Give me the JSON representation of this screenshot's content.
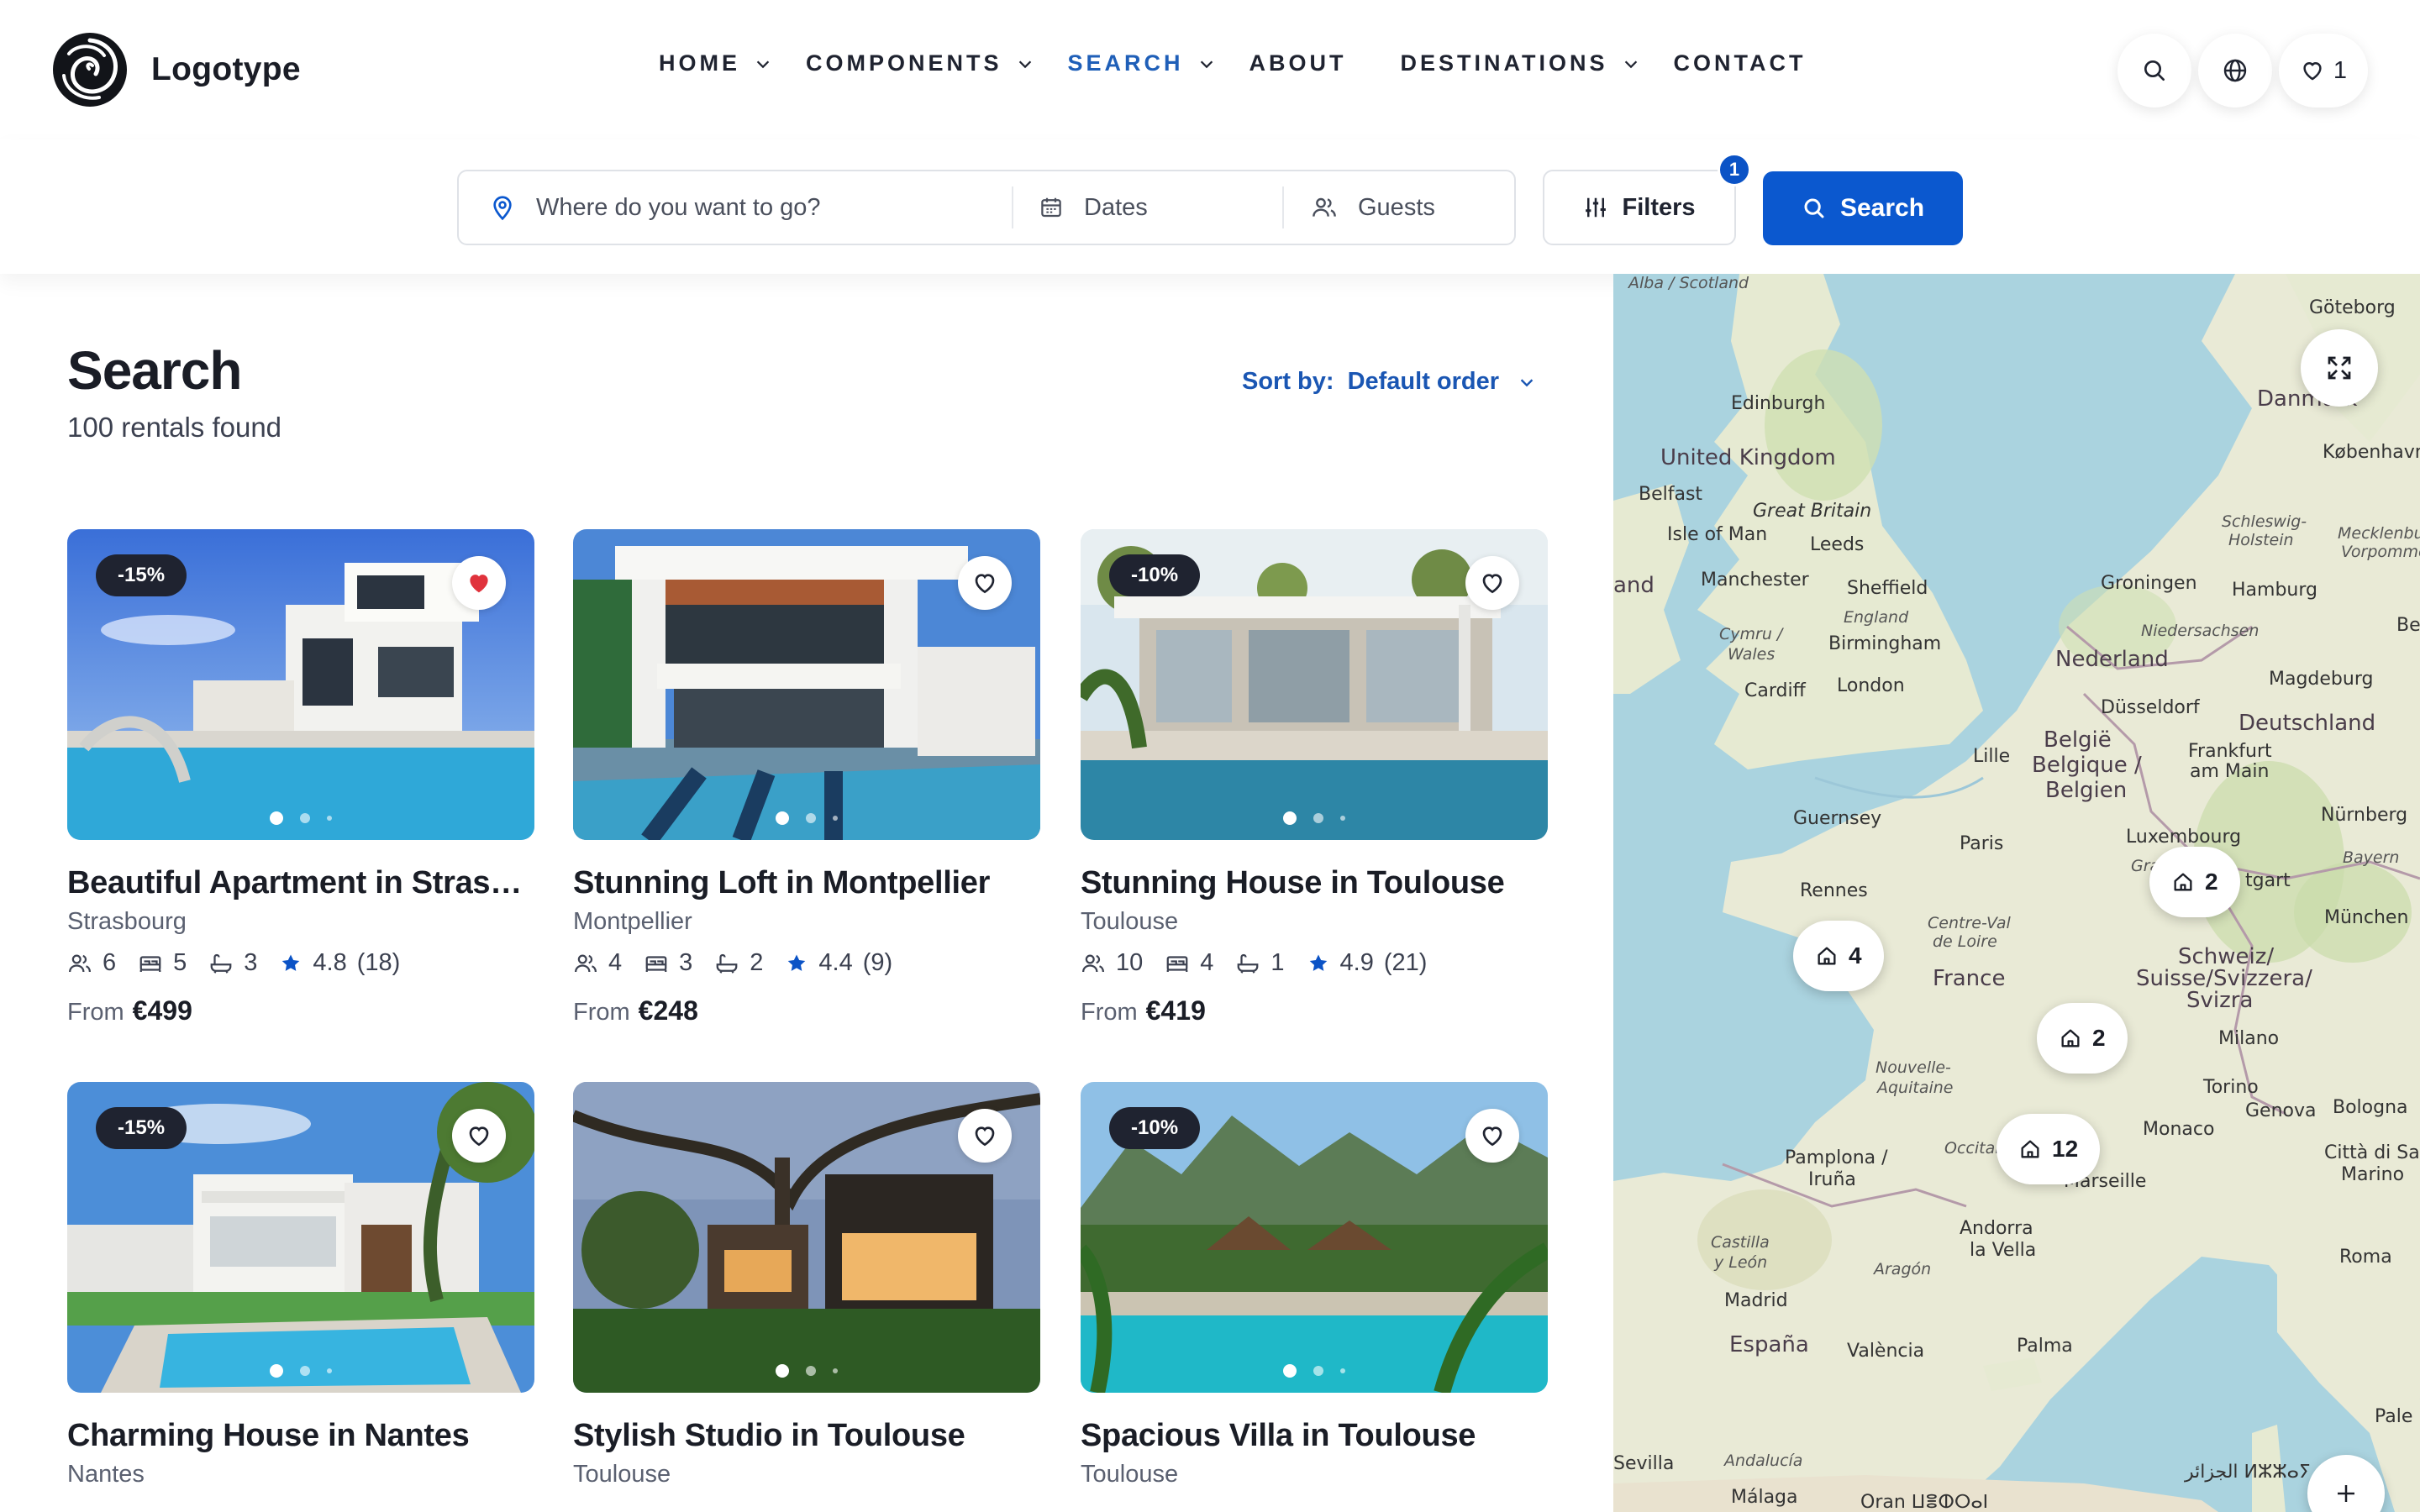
{
  "app": {
    "logo_text": "Logotype"
  },
  "nav": {
    "items": [
      {
        "label": "HOME",
        "has_dropdown": true
      },
      {
        "label": "COMPONENTS",
        "has_dropdown": true
      },
      {
        "label": "SEARCH",
        "has_dropdown": true,
        "active": true
      },
      {
        "label": "ABOUT",
        "has_dropdown": false
      },
      {
        "label": "DESTINATIONS",
        "has_dropdown": true
      },
      {
        "label": "CONTACT",
        "has_dropdown": false
      }
    ]
  },
  "header_actions": {
    "wishlist_count": "1",
    "icons": [
      "search-icon",
      "globe-icon",
      "heart-icon"
    ]
  },
  "search_bar": {
    "destination_placeholder": "Where do you want to go?",
    "dates_placeholder": "Dates",
    "guests_placeholder": "Guests",
    "filters_label": "Filters",
    "filters_count": "1",
    "search_label": "Search"
  },
  "results": {
    "title": "Search",
    "count_text": "100 rentals found",
    "sort_label": "Sort by:",
    "sort_value": "Default order"
  },
  "listings": [
    {
      "title": "Beautiful Apartment in Strasbourg",
      "city": "Strasbourg",
      "discount": "-15%",
      "favorited": true,
      "guests": "6",
      "bedrooms": "5",
      "baths": "3",
      "rating": "4.8",
      "reviews": "(18)",
      "price_prefix": "From",
      "price": "€499"
    },
    {
      "title": "Stunning Loft in Montpellier",
      "city": "Montpellier",
      "discount": "",
      "favorited": false,
      "guests": "4",
      "bedrooms": "3",
      "baths": "2",
      "rating": "4.4",
      "reviews": "(9)",
      "price_prefix": "From",
      "price": "€248"
    },
    {
      "title": "Stunning House in Toulouse",
      "city": "Toulouse",
      "discount": "-10%",
      "favorited": false,
      "guests": "10",
      "bedrooms": "4",
      "baths": "1",
      "rating": "4.9",
      "reviews": "(21)",
      "price_prefix": "From",
      "price": "€419"
    },
    {
      "title": "Charming House in Nantes",
      "city": "Nantes",
      "discount": "-15%",
      "favorited": false
    },
    {
      "title": "Stylish Studio in Toulouse",
      "city": "Toulouse",
      "discount": "",
      "favorited": false
    },
    {
      "title": "Spacious Villa in Toulouse",
      "city": "Toulouse",
      "discount": "-10%",
      "favorited": false
    }
  ],
  "map": {
    "clusters": [
      {
        "count": "4"
      },
      {
        "count": "2"
      },
      {
        "count": "2"
      },
      {
        "count": "12"
      }
    ],
    "labels": {
      "alba": "Alba / Scotland",
      "edinburgh": "Edinburgh",
      "uk": "United Kingdom",
      "belfast": "Belfast",
      "great_britain": "Great Britain",
      "isle_of_man": "Isle of Man",
      "leeds": "Leeds",
      "ireland": "and",
      "manchester": "Manchester",
      "sheffield": "Sheffield",
      "england": "England",
      "birmingham": "Birmingham",
      "cymru": "Cymru /",
      "wales": "Wales",
      "cardiff": "Cardiff",
      "london": "London",
      "lille": "Lille",
      "guernsey": "Guernsey",
      "paris": "Paris",
      "rennes": "Rennes",
      "centre": "Centre-Val",
      "de_loire": "de Loire",
      "france": "France",
      "nouvelle": "Nouvelle-",
      "aquitaine": "Aquitaine",
      "pamplona": "Pamplona /",
      "iruna": "Iruña",
      "occitanie": "Occitan",
      "marseille": "Marseille",
      "andorra": "Andorra",
      "la_vella": "la Vella",
      "castilla": "Castilla",
      "y_leon": "y León",
      "aragon": "Aragón",
      "madrid": "Madrid",
      "espana": "España",
      "valencia": "València",
      "palma": "Palma",
      "sevilla": "Sevilla",
      "andalucia": "Andalucía",
      "malaga": "Málaga",
      "oran": "Oran ⵡⴻⵀⵔⴰⵏ",
      "goteborg": "Göteborg",
      "danmark": "Danmark",
      "kobenhavn": "København",
      "schleswig": "Schleswig-",
      "holstein": "Holstein",
      "mecklenburg": "Mecklenbur",
      "vorpommern": "Vorpommer",
      "groningen": "Groningen",
      "hamburg": "Hamburg",
      "berlin": "Berl",
      "niedersachsen": "Niedersachsen",
      "nederland": "Nederland",
      "magdeburg": "Magdeburg",
      "dusseldorf": "Düsseldorf",
      "deutschland": "Deutschland",
      "belgie": "België",
      "belgique": "Belgique /",
      "belgien": "Belgien",
      "frankfurt": "Frankfurt",
      "am_main": "am Main",
      "nurnberg": "Nürnberg",
      "luxembourg": "Luxembourg",
      "bayern": "Bayern",
      "grand_est": "Grand Es",
      "stuttgart": "tgart",
      "munchen": "München",
      "schweiz": "Schweiz/",
      "suisse": "Suisse/Svizzera/",
      "svizra": "Svizra",
      "milano": "Milano",
      "torino": "Torino",
      "genova": "Genova",
      "bologna": "Bologna",
      "monaco": "Monaco",
      "citta": "Città di San",
      "marino": "Marino",
      "roma": "Roma",
      "palermo": "Pale",
      "algeria": "الجزائر ⵍⵣⵣⴰⵢ"
    }
  },
  "colors": {
    "accent": "#0b58cf",
    "nav_active": "#1f5fb8",
    "sort": "#1a56b3",
    "badge_dark": "#1f2330",
    "fav_red": "#e0323c",
    "star": "#0b53c6",
    "sea": "#aad3df",
    "land": "#e9ead6"
  }
}
